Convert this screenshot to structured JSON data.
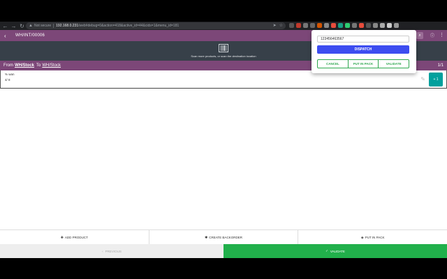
{
  "browser": {
    "security_label": "Not secure",
    "url_host": "192.168.0.231",
    "url_path": "/web#debug=0&action=418&active_id=44&cids=1&menu_id=181"
  },
  "app": {
    "title": "WH/INT/00006"
  },
  "scan": {
    "hint": "Scan more products, or scan the destination location"
  },
  "location": {
    "from_label": "From",
    "source": "WH/Stock",
    "to_label": "To",
    "destination": "WH/Stock",
    "page_count": "1/1"
  },
  "line": {
    "product": "% wan",
    "quantity": "4/ 8",
    "increment_label": "+ 1"
  },
  "actions": {
    "add_product": "ADD PRODUCT",
    "create_backorder": "CREATE BACKORDER",
    "put_in_pack": "PUT IN PACK"
  },
  "footer": {
    "previous": "PREVIOUS",
    "validate": "VALIDATE"
  },
  "popup": {
    "input_value": "123456463567",
    "dispatch": "DISPATCH",
    "cancel": "CANCEL",
    "put_in_pack": "PUT IN PACK",
    "validate": "VALIDATE"
  },
  "colors": {
    "odoo_purple": "#7c4778",
    "scan_bg": "#374049",
    "validate_green": "#21b04b",
    "dispatch_blue": "#3d4df0",
    "teal": "#00a09d"
  }
}
